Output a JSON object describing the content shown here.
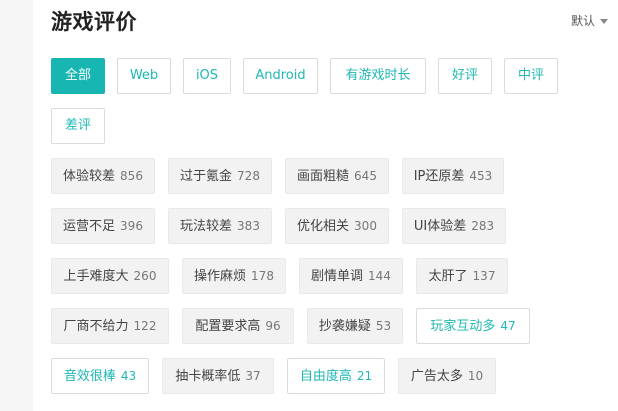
{
  "header": {
    "title": "游戏评价",
    "sort_label": "默认",
    "sort_icon": "caret-down-icon"
  },
  "filters": [
    {
      "label": "全部",
      "active": true
    },
    {
      "label": "Web"
    },
    {
      "label": "iOS"
    },
    {
      "label": "Android"
    },
    {
      "label": "有游戏时长"
    },
    {
      "label": "好评"
    },
    {
      "label": "中评"
    },
    {
      "label": "差评"
    }
  ],
  "tags": [
    {
      "label": "体验较差",
      "count": "856"
    },
    {
      "label": "过于氪金",
      "count": "728"
    },
    {
      "label": "画面粗糙",
      "count": "645"
    },
    {
      "label": "IP还原差",
      "count": "453"
    },
    {
      "label": "运营不足",
      "count": "396"
    },
    {
      "label": "玩法较差",
      "count": "383"
    },
    {
      "label": "优化相关",
      "count": "300"
    },
    {
      "label": "UI体验差",
      "count": "283"
    },
    {
      "label": "上手难度大",
      "count": "260"
    },
    {
      "label": "操作麻烦",
      "count": "178"
    },
    {
      "label": "剧情单调",
      "count": "144"
    },
    {
      "label": "太肝了",
      "count": "137"
    },
    {
      "label": "厂商不给力",
      "count": "122"
    },
    {
      "label": "配置要求高",
      "count": "96"
    },
    {
      "label": "抄袭嫌疑",
      "count": "53"
    },
    {
      "label": "玩家互动多",
      "count": "47",
      "highlight": true
    },
    {
      "label": "音效很棒",
      "count": "43",
      "highlight": true
    },
    {
      "label": "抽卡概率低",
      "count": "37"
    },
    {
      "label": "自由度高",
      "count": "21",
      "highlight": true
    },
    {
      "label": "广告太多",
      "count": "10"
    }
  ],
  "colors": {
    "accent": "#17b6b3",
    "tag_bg": "#f2f2f2",
    "border": "#dcdcdc"
  }
}
